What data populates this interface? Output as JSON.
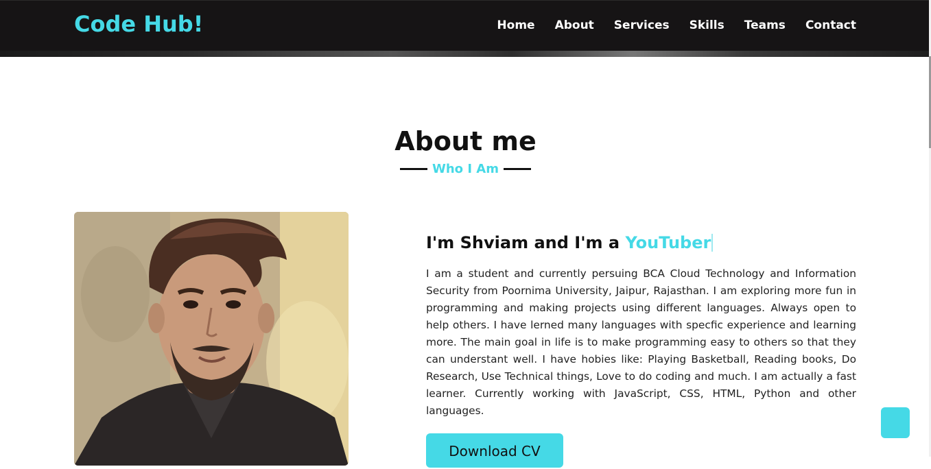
{
  "brand": "Code Hub!",
  "nav": {
    "items": [
      {
        "label": "Home"
      },
      {
        "label": "About"
      },
      {
        "label": "Services"
      },
      {
        "label": "Skills"
      },
      {
        "label": "Teams"
      },
      {
        "label": "Contact"
      }
    ]
  },
  "about": {
    "title": "About me",
    "subtitle": "Who I Am",
    "headline_prefix": "I'm Shviam and I'm a ",
    "headline_role": "YouTuber",
    "bio": "I am a student and currently persuing BCA Cloud Technology and Information Security from Poornima University, Jaipur, Rajasthan. I am exploring more fun in programming and making projects using different languages. Always open to help others. I have lerned many languages with specfic experience and learning more. The main goal in life is to make programming easy to others so that they can understant well. I have hobies like: Playing Basketball, Reading books, Do Research, Use Technical things, Love to do coding and much. I am actually a fast learner. Currently working with JavaScript, CSS, HTML, Python and other languages.",
    "download_label": "Download CV"
  },
  "colors": {
    "accent": "#45d9e6",
    "navbar": "#161415"
  }
}
